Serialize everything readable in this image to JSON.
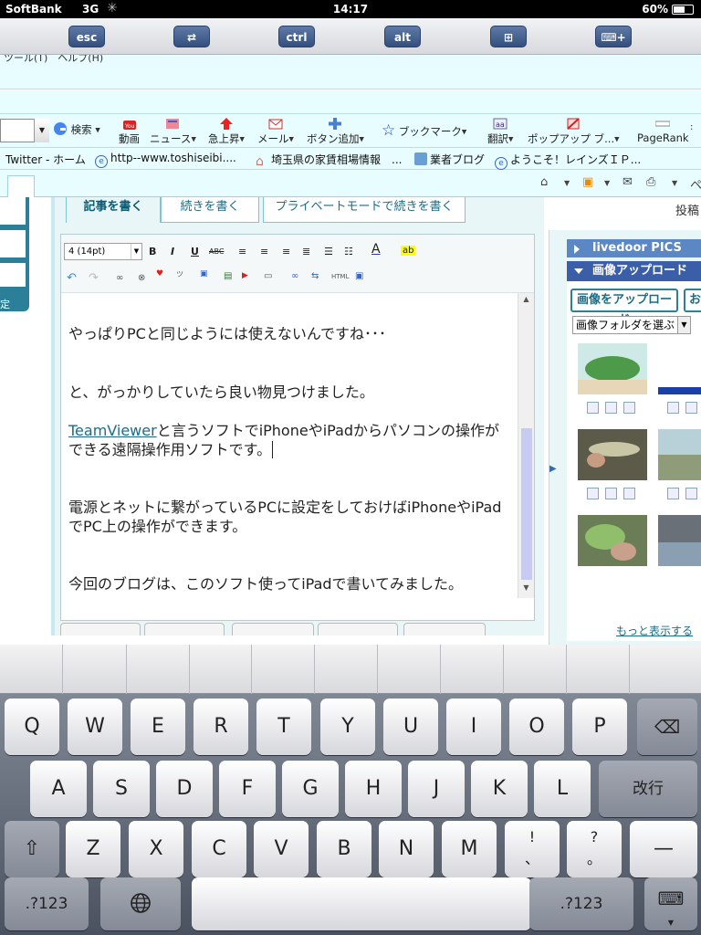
{
  "status": {
    "carrier": "SoftBank",
    "network": "3G",
    "time": "14:17",
    "battery": "60%"
  },
  "special_keys": {
    "esc": "esc",
    "switch": "⇄",
    "ctrl": "ctrl",
    "alt": "alt",
    "win": "⊞",
    "keyboard": "⌨+"
  },
  "menu_row": "ツール(T)　ヘルプ(H)",
  "toolbar": {
    "search": "検索",
    "video": "動画",
    "news": "ニュース",
    "rising": "急上昇",
    "mail": "メール",
    "add_button": "ボタン追加",
    "bookmark": "ブックマーク",
    "translate": "翻訳",
    "popup": "ポップアップ ブ...",
    "pagerank": "PageRank"
  },
  "favorites": [
    "Twitter - ホーム",
    "http--www.toshiseibi....",
    "埼玉県の家賃相場情報　...",
    "業者ブログ",
    "ようこそ！レインズＩＰ..."
  ],
  "left_panel": {
    "label": "定"
  },
  "editor_tabs": [
    "記事を書く",
    "続きを書く",
    "プライベートモードで続きを書く"
  ],
  "right_tab": "投稿",
  "format": {
    "font_size": "4 (14pt)",
    "bold": "B",
    "italic": "I",
    "underline": "U",
    "strike": "ABC",
    "html": "HTML"
  },
  "content": {
    "p1": "やっぱりPCと同じようには使えないんですね･･･",
    "p2": "と、がっかりしていたら良い物見つけました。",
    "link": "TeamViewer",
    "p3_rest": "と言うソフトでiPhoneやiPadからパソコンの操作ができる遠隔操作用ソフトです。",
    "p4": "電源とネットに繋がっているPCに設定をしておけばiPhoneやiPadでPC上の操作ができます。",
    "p5": "今回のブログは、このソフト使ってiPadで書いてみました。"
  },
  "sidebar": {
    "livedoor": "livedoor PICS",
    "upload_head": "画像アップロード",
    "upload_button": "画像をアップロード",
    "upload_button2": "お",
    "folder_select": "画像フォルダを選ぶ",
    "more": "もっと表示する"
  },
  "keyboard": {
    "row1": [
      "Q",
      "W",
      "E",
      "R",
      "T",
      "Y",
      "U",
      "I",
      "O",
      "P"
    ],
    "row2": [
      "A",
      "S",
      "D",
      "F",
      "G",
      "H",
      "J",
      "K",
      "L"
    ],
    "row3": [
      "Z",
      "X",
      "C",
      "V",
      "B",
      "N",
      "M",
      "!\n、",
      "?\n。",
      "—"
    ],
    "return": "改行",
    "num": ".?123",
    "globe": "globe",
    "backspace": "backspace",
    "shift": "shift",
    "hide": "hide-keyboard"
  },
  "colors": {
    "accent": "#2c7f98",
    "chrome_bg": "#e8fdff",
    "link": "#1b6d86"
  }
}
